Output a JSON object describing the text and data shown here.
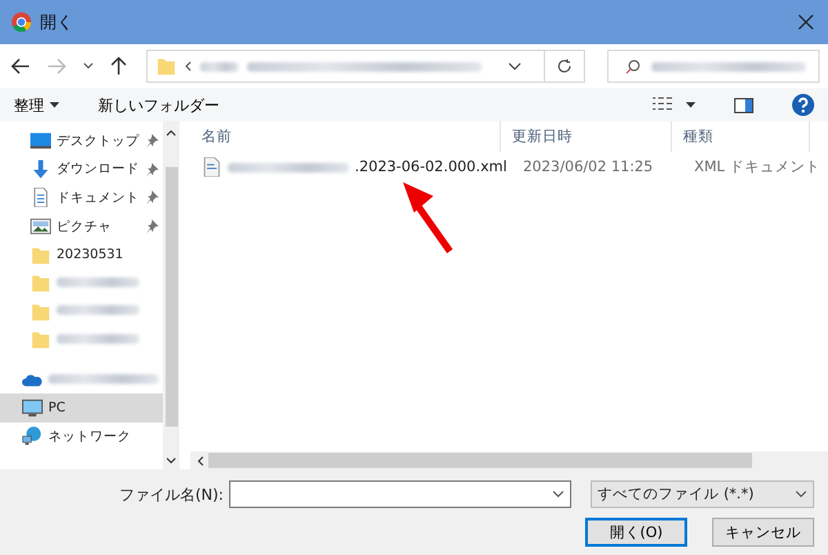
{
  "window": {
    "title": "開く"
  },
  "toolbar": {
    "organize": "整理",
    "new_folder": "新しいフォルダー"
  },
  "sidebar": {
    "sections": [
      {
        "items": [
          {
            "kind": "desktop",
            "label": "デスクトップ",
            "pinned": true,
            "selected": false
          },
          {
            "kind": "download",
            "label": "ダウンロード",
            "pinned": true,
            "selected": false
          },
          {
            "kind": "document",
            "label": "ドキュメント",
            "pinned": true,
            "selected": false
          },
          {
            "kind": "picture",
            "label": "ピクチャ",
            "pinned": true,
            "selected": false
          },
          {
            "kind": "folder",
            "label": "20230531",
            "pinned": false,
            "selected": false
          },
          {
            "kind": "folder",
            "pinned": false,
            "selected": false
          },
          {
            "kind": "folder",
            "pinned": false,
            "selected": false
          },
          {
            "kind": "folder",
            "pinned": false,
            "selected": false
          }
        ]
      },
      {
        "items": [
          {
            "kind": "cloud",
            "selected": false
          },
          {
            "kind": "pc",
            "label": "PC",
            "selected": true
          },
          {
            "kind": "network",
            "label": "ネットワーク",
            "selected": false
          }
        ]
      }
    ]
  },
  "table": {
    "columns": [
      "名前",
      "更新日時",
      "種類"
    ],
    "rows": [
      {
        "name": ".2023-06-02.000.xml",
        "modified": "2023/06/02 11:25",
        "type": "XML ドキュメント"
      }
    ]
  },
  "footer": {
    "filename_label": "ファイル名(N):",
    "filter": "すべてのファイル (*.*)",
    "open": "開く(O)",
    "cancel": "キャンセル"
  }
}
